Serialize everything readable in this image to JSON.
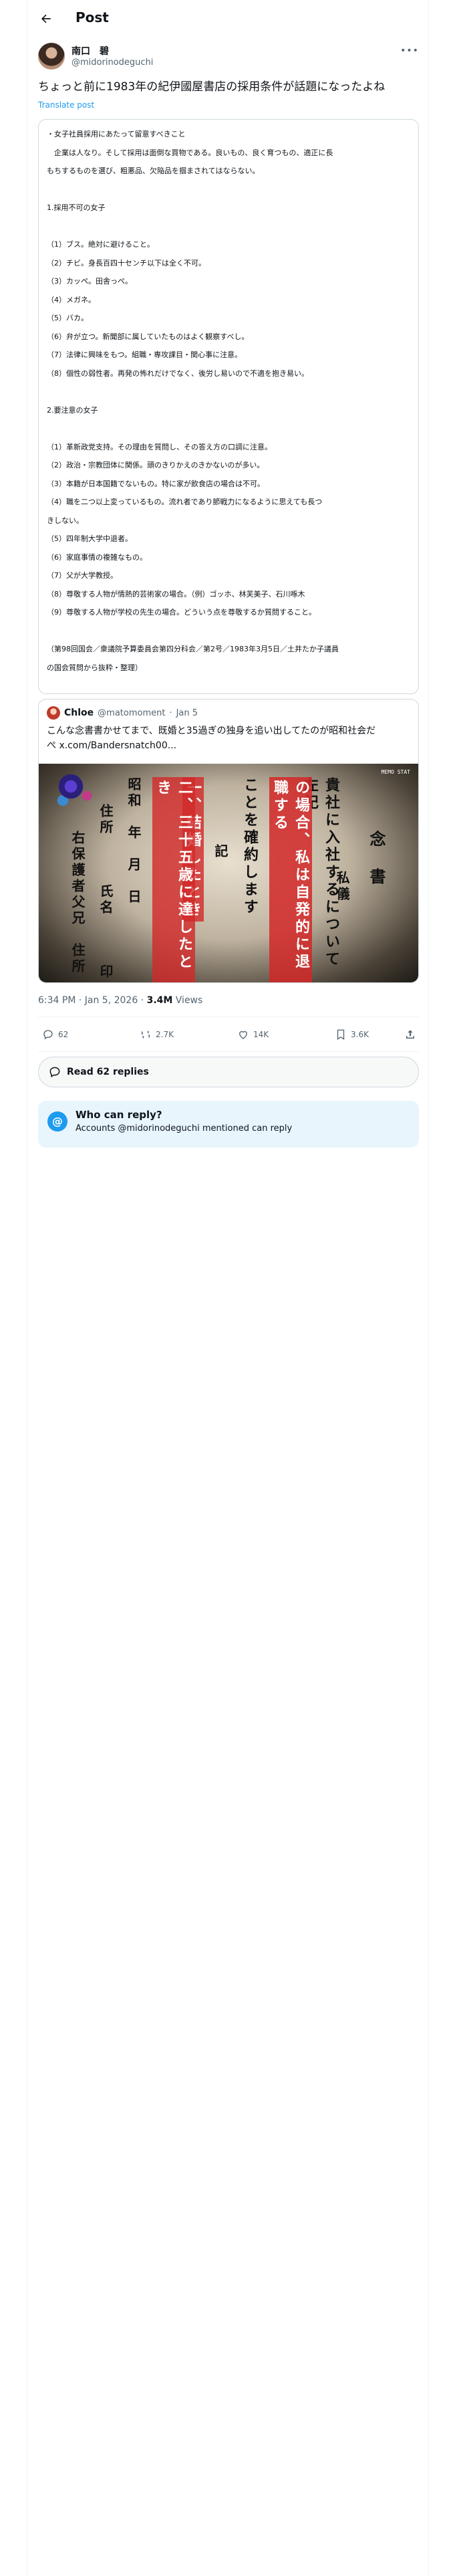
{
  "header": {
    "title": "Post"
  },
  "author": {
    "name": "南口　碧",
    "handle": "@midorinodeguchi"
  },
  "tweet": {
    "text": "ちょっと前に1983年の紀伊國屋書店の採用条件が話題になったよね",
    "translate_label": "Translate post"
  },
  "card_lines": [
    "・女子社員採用にあたって留意すべきこと",
    "　企業は人なり。そして採用は面倒な買物である。良いもの、良く育つもの、適正に長",
    "もちするものを選び、粗悪品、欠陥品を掴まされてはならない。",
    "",
    "1.採用不可の女子",
    "",
    "（1）ブス。絶対に避けること。",
    "（2）チビ。身長百四十センチ以下は全く不可。",
    "（3）カッペ。田舎っぺ。",
    "（4）メガネ。",
    "（5）バカ。",
    "（6）弁が立つ。新聞部に属していたものはよく観察すべし。",
    "（7）法律に興味をもつ。組職・専攻課目・関心事に注意。",
    "（8）個性の弱性者。再発の怖れだけでなく、後労し易いので不適を抱き易い。",
    "",
    "2.要注意の女子",
    "",
    "（1）革新政党支持。その理由を質問し、その答え方の口調に注意。",
    "（2）政治・宗教団体に関係。頭のきりかえのきかないのが多い。",
    "（3）本籍が日本国籍でないもの。特に家が飲食店の場合は不可。",
    "（4）職を二つ以上変っているもの。流れ者であり節戦力になるように思えても長つ",
    "きしない。",
    "（5）四年制大学中退者。",
    "（6）家庭事情の複雑なもの。",
    "（7）父が大学教授。",
    "（8）尊敬する人物が情熱的芸術家の場合。（例）ゴッホ、林芙美子、石川啄木",
    "（9）尊敬する人物が学校の先生の場合。どういう点を尊敬するか質問すること。",
    "",
    "（第98回国会／衆議院予算委員会第四分科会／第2号／1983年3月5日／土井たか子議員",
    "の国会質問から抜粋・整理）"
  ],
  "quote": {
    "name": "Chloe",
    "handle": "@matomoment",
    "date": "Jan 5",
    "text": "こんな念書書かせてまで、既婚と35過ぎの独身を追い出してたのが昭和社会だ",
    "text2": "ぺ x.com/Bandersnatch00...",
    "media": {
      "corner_tag": "MEMO STAT",
      "col_title": "念　書",
      "col_1": "私儀",
      "col_2": "貴社に入社するについて左記",
      "col_3": "の場合、私は自発的に退職する",
      "col_4": "ことを確約します",
      "col_5": "記",
      "col_6": "一、結婚したとき",
      "col_7": "二、三十五歳に達したとき",
      "col_8": "昭和　年　月　日",
      "col_9": "住所　　　氏名　　　印",
      "col_10": "右保護者父兄　住所"
    }
  },
  "post_meta": {
    "time": "6:34 PM · Jan 5, 2026 · ",
    "views_count": "3.4M",
    "views_label": " Views"
  },
  "actions": {
    "replies": "62",
    "reposts": "2.7K",
    "likes": "14K",
    "bookmarks": "3.6K"
  },
  "read_replies_label": "Read 62 replies",
  "who_can_reply": {
    "title": "Who can reply?",
    "subtitle": "Accounts @midorinodeguchi mentioned can reply"
  }
}
